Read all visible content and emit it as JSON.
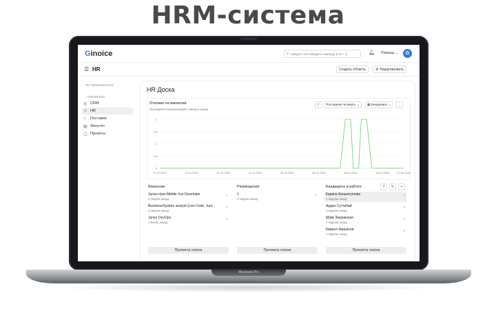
{
  "promo_title": "HRM-система",
  "laptop_label": "Macbook Pro",
  "app": {
    "logo_first": "G",
    "logo_rest": "inoice",
    "search_placeholder": "Найдите или введите команду (Ctrl + I)",
    "help": "Помощь ⌄",
    "avatar": "G"
  },
  "subbar": {
    "section": "HR",
    "create_area": "Создать область",
    "edit": "Редактировать"
  },
  "sidebar": {
    "workspaces_caption": "› MY WORKSPACES",
    "public_caption": "⌄ ПУБЛИЧНО",
    "items": [
      {
        "icon": "◎",
        "label": "CRM"
      },
      {
        "icon": "☺",
        "label": "HR"
      },
      {
        "icon": "⌂",
        "label": "Поставки"
      },
      {
        "icon": "▤",
        "label": "Финучет"
      },
      {
        "icon": "▢",
        "label": "Проекты"
      }
    ]
  },
  "main": {
    "title": "HR Доска",
    "chart_card": {
      "title": "Отклики на вакансии",
      "subtitle": "Последняя синхронизация 1 минуту назад",
      "filter_icon": "▽",
      "period": "Последняя четверть ⌄",
      "granularity": "Ежедневно ⌄",
      "more": "···"
    },
    "vacancies": {
      "title": "Вакансии",
      "items": [
        {
          "title": "Junior+/pre-Middle Vue Developer",
          "sub": "2 недели назад"
        },
        {
          "title": "Business/System analyst (Low Code, Juni...",
          "sub": "2 недели назад"
        },
        {
          "title": "Junior DevOps",
          "sub": "1 месяц назад"
        }
      ],
      "button": "Просмотр списка"
    },
    "placements": {
      "title": "Размещения",
      "items": [
        {
          "title": "1",
          "sub": "2 недели назад"
        }
      ],
      "button": "Просмотр списка"
    },
    "candidates": {
      "title": "Кандидаты в работе",
      "items": [
        {
          "title": "Карина Кинькитупова",
          "sub": "1 неделю назад"
        },
        {
          "title": "Ардан Суттибай",
          "sub": "1 неделю назад"
        },
        {
          "title": "Майк Закревская",
          "sub": "1 неделю назад"
        },
        {
          "title": "Кирилл Кирьянов",
          "sub": "1 неделю назад"
        }
      ],
      "button": "Просмотр списка"
    }
  },
  "colors": {
    "accent": "#2f7de1",
    "line": "#5ccf6c"
  },
  "chart_data": {
    "type": "line",
    "title": "Отклики на вакансии",
    "x_ticks": [
      "07-11-2023",
      "19-11-2023",
      "01-12-2023",
      "13-12-2023",
      "25-12-2023",
      "06-01-2024",
      "18-01-2024",
      "30-01-2024",
      "07-02-2024"
    ],
    "ylim": [
      0,
      2
    ],
    "y_ticks": [
      "0",
      "0.5",
      "1",
      "1.5",
      "2"
    ],
    "series": [
      {
        "points": [
          [
            "07-11-2023",
            0
          ],
          [
            "14-01-2024",
            0
          ],
          [
            "16-01-2024",
            2
          ],
          [
            "18-01-2024",
            2
          ],
          [
            "19-01-2024",
            0
          ],
          [
            "21-01-2024",
            0
          ],
          [
            "22-01-2024",
            2
          ],
          [
            "24-01-2024",
            2
          ],
          [
            "26-01-2024",
            0
          ],
          [
            "07-02-2024",
            0
          ]
        ]
      }
    ]
  }
}
